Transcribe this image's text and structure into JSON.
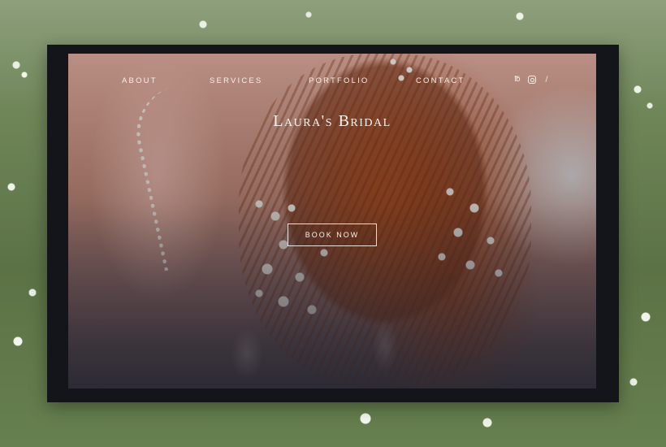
{
  "nav": {
    "items": [
      {
        "label": "ABOUT"
      },
      {
        "label": "SERVICES"
      },
      {
        "label": "PORTFOLIO"
      },
      {
        "label": "CONTACT"
      }
    ],
    "social": [
      {
        "icon": "pinterest-icon",
        "glyph": "℔"
      },
      {
        "icon": "instagram-icon",
        "glyph": ""
      },
      {
        "icon": "link-icon",
        "glyph": "∕"
      }
    ]
  },
  "hero": {
    "title": "Laura's Bridal",
    "cta_label": "BOOK NOW"
  },
  "colors": {
    "frame": "#14151b",
    "text": "#f6efe9",
    "hair": "#b2562c"
  }
}
